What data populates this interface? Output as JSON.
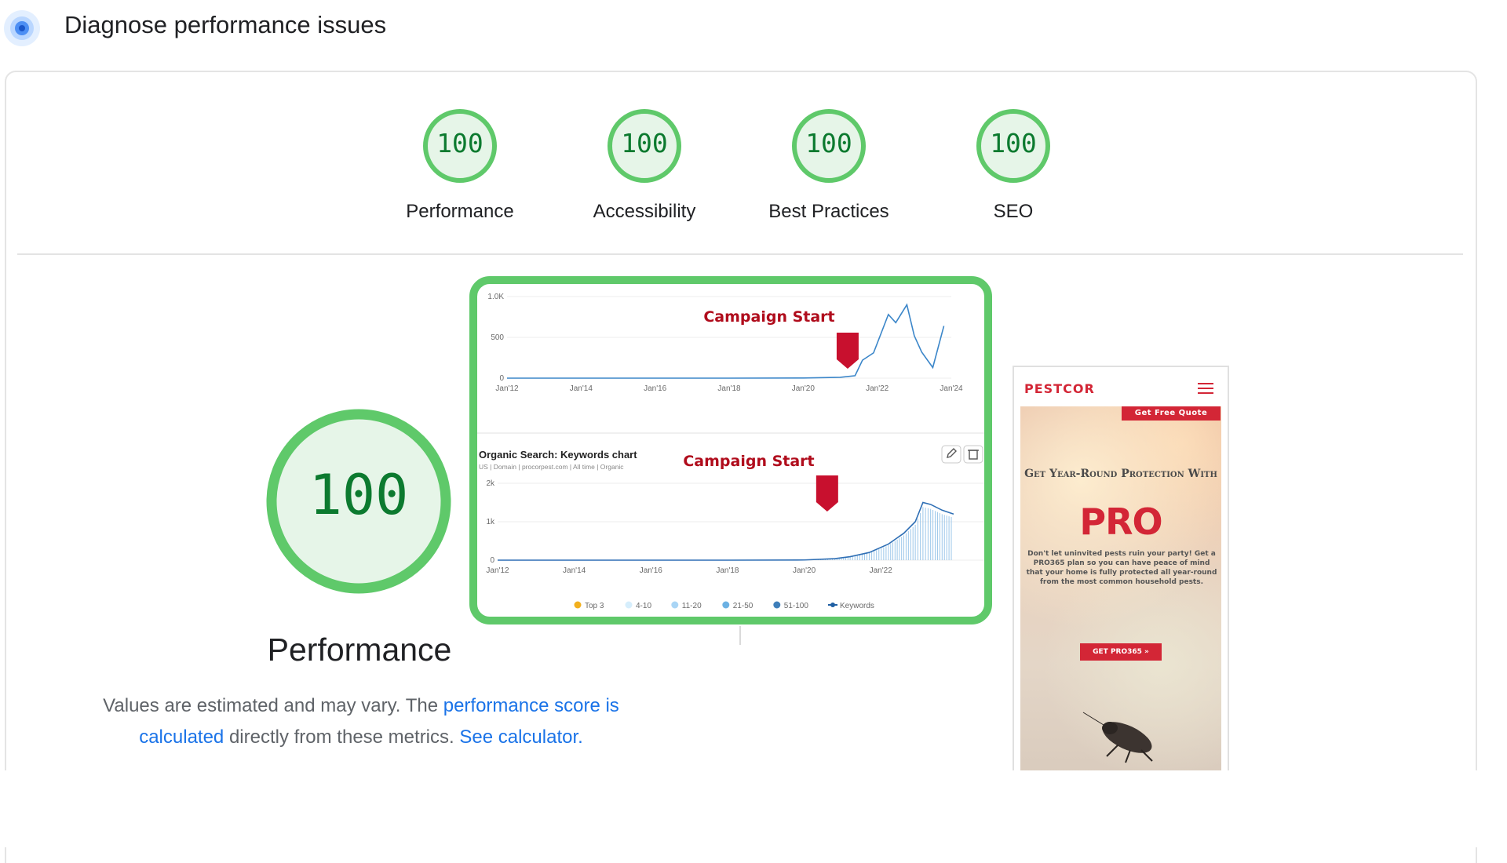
{
  "header": {
    "title": "Diagnose performance issues",
    "icon": "lighthouse-icon"
  },
  "scores": [
    {
      "value": "100",
      "label": "Performance"
    },
    {
      "value": "100",
      "label": "Accessibility"
    },
    {
      "value": "100",
      "label": "Best Practices"
    },
    {
      "value": "100",
      "label": "SEO"
    }
  ],
  "performance": {
    "score": "100",
    "label": "Performance",
    "desc_text1": "Values are estimated and may vary. The ",
    "desc_link1": "performance score is calculated",
    "desc_text2": " directly from these metrics. ",
    "desc_link2": "See calculator."
  },
  "colors": {
    "pass_green": "#0c7a2f",
    "gauge_ring": "#5fc96a",
    "gauge_fill": "#e6f5e8",
    "link": "#1a73e8",
    "campaign_red": "#b00c1c"
  },
  "chart_data": [
    {
      "type": "line",
      "y_ticks": [
        "1.0K",
        "500",
        "0"
      ],
      "x_ticks": [
        "Jan'12",
        "Jan'14",
        "Jan'16",
        "Jan'18",
        "Jan'20",
        "Jan'22",
        "Jan'24"
      ],
      "ylim": [
        0,
        1000
      ],
      "annotation": "Campaign Start",
      "series": [
        {
          "x": [
            2012,
            2014,
            2016,
            2018,
            2020,
            2021,
            2021.4,
            2021.6,
            2021.9,
            2022.3,
            2022.5,
            2022.8,
            2023.0,
            2023.2,
            2023.5,
            2023.8
          ],
          "values": [
            0,
            0,
            0,
            0,
            2,
            10,
            30,
            220,
            310,
            780,
            680,
            900,
            520,
            320,
            130,
            640
          ]
        }
      ]
    },
    {
      "type": "area",
      "title": "Organic Search: Keywords chart",
      "subtitle": "US | Domain | procorpest.com | All time | Organic",
      "y_ticks": [
        "2k",
        "1k",
        "0"
      ],
      "x_ticks": [
        "Jan'12",
        "Jan'14",
        "Jan'16",
        "Jan'18",
        "Jan'20",
        "Jan'22"
      ],
      "ylim": [
        0,
        2000
      ],
      "annotation": "Campaign Start",
      "legend": [
        "Top 3",
        "4-10",
        "11-20",
        "21-50",
        "51-100",
        "Keywords"
      ],
      "series": [
        {
          "x": [
            2012,
            2014,
            2016,
            2018,
            2020,
            2020.8,
            2021.2,
            2021.7,
            2022.2,
            2022.6,
            2022.9,
            2023.1,
            2023.3,
            2023.6,
            2023.9
          ],
          "values": [
            0,
            0,
            0,
            0,
            5,
            40,
            90,
            200,
            420,
            700,
            1000,
            1500,
            1450,
            1300,
            1200
          ]
        }
      ]
    }
  ],
  "phone": {
    "logo": "PESTCOR",
    "quote_button": "Get Free Quote",
    "headline": "Get Year-Round Protection With",
    "brand": "PRO",
    "body": "Don't let uninvited pests ruin your party! Get a PRO365 plan so you can have peace of mind that your home is fully protected all year-round from the most common household pests.",
    "cta": "GET PRO365 »"
  }
}
